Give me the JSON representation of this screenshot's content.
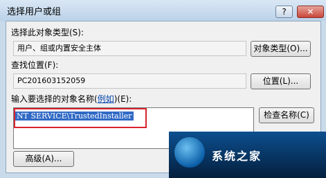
{
  "dialog": {
    "title": "选择用户或组",
    "help_label": "?",
    "close_label": "✕"
  },
  "object_type": {
    "label": "选择此对象类型(S):",
    "value": "用户、组或内置安全主体",
    "button_label": "对象类型(O)..."
  },
  "location": {
    "label": "查找位置(F):",
    "value": "PC201603152059",
    "button_label": "位置(L)..."
  },
  "names": {
    "label_prefix": "输入要选择的对象名称(",
    "label_link": "例如",
    "label_suffix": ")(E):",
    "value": "NT SERVICE\\TrustedInstaller",
    "check_button_label": "检查名称(C)"
  },
  "advanced_button_label": "高级(A)...",
  "watermark": {
    "text": "系统之家",
    "icon": "globe-logo-icon"
  },
  "colors": {
    "highlight": "#316ac5",
    "annotation_border": "#d9232d"
  }
}
